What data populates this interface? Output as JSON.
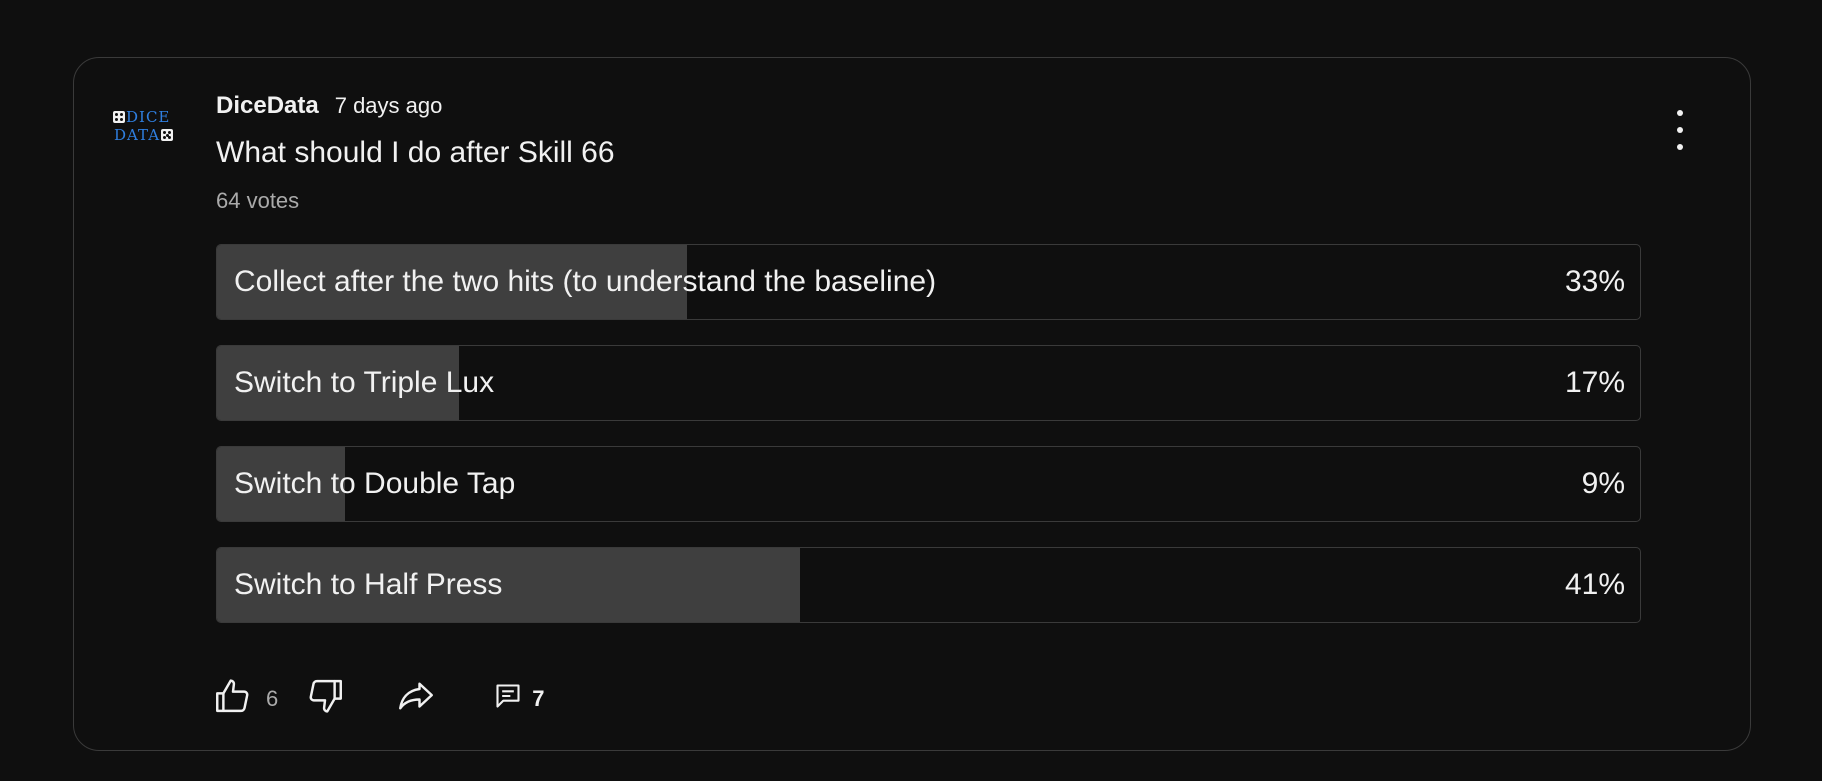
{
  "post": {
    "author": "DiceData",
    "time": "7 days ago",
    "avatar": {
      "line1": "DICE",
      "line2": "DATA",
      "color": "#2f7fe0"
    },
    "question": "What should I do after Skill 66",
    "votes": "64 votes"
  },
  "poll": {
    "options": [
      {
        "label": "Collect after the two hits (to understand the baseline)",
        "percent_text": "33%",
        "fill": 0.33
      },
      {
        "label": "Switch to Triple Lux",
        "percent_text": "17%",
        "fill": 0.17
      },
      {
        "label": "Switch to Double Tap",
        "percent_text": "9%",
        "fill": 0.09
      },
      {
        "label": "Switch to Half Press",
        "percent_text": "41%",
        "fill": 0.41
      }
    ]
  },
  "actions": {
    "like_count": "6",
    "comment_count": "7",
    "icons": [
      "thumbs-up-icon",
      "thumbs-down-icon",
      "share-icon",
      "comment-icon",
      "more-vert-icon"
    ]
  },
  "colors": {
    "background": "#0f0f0f",
    "border": "#3a3a3a",
    "bar_fill": "#3f3f3f",
    "text": "#f1f1f1",
    "muted_text": "#aaaaaa"
  }
}
